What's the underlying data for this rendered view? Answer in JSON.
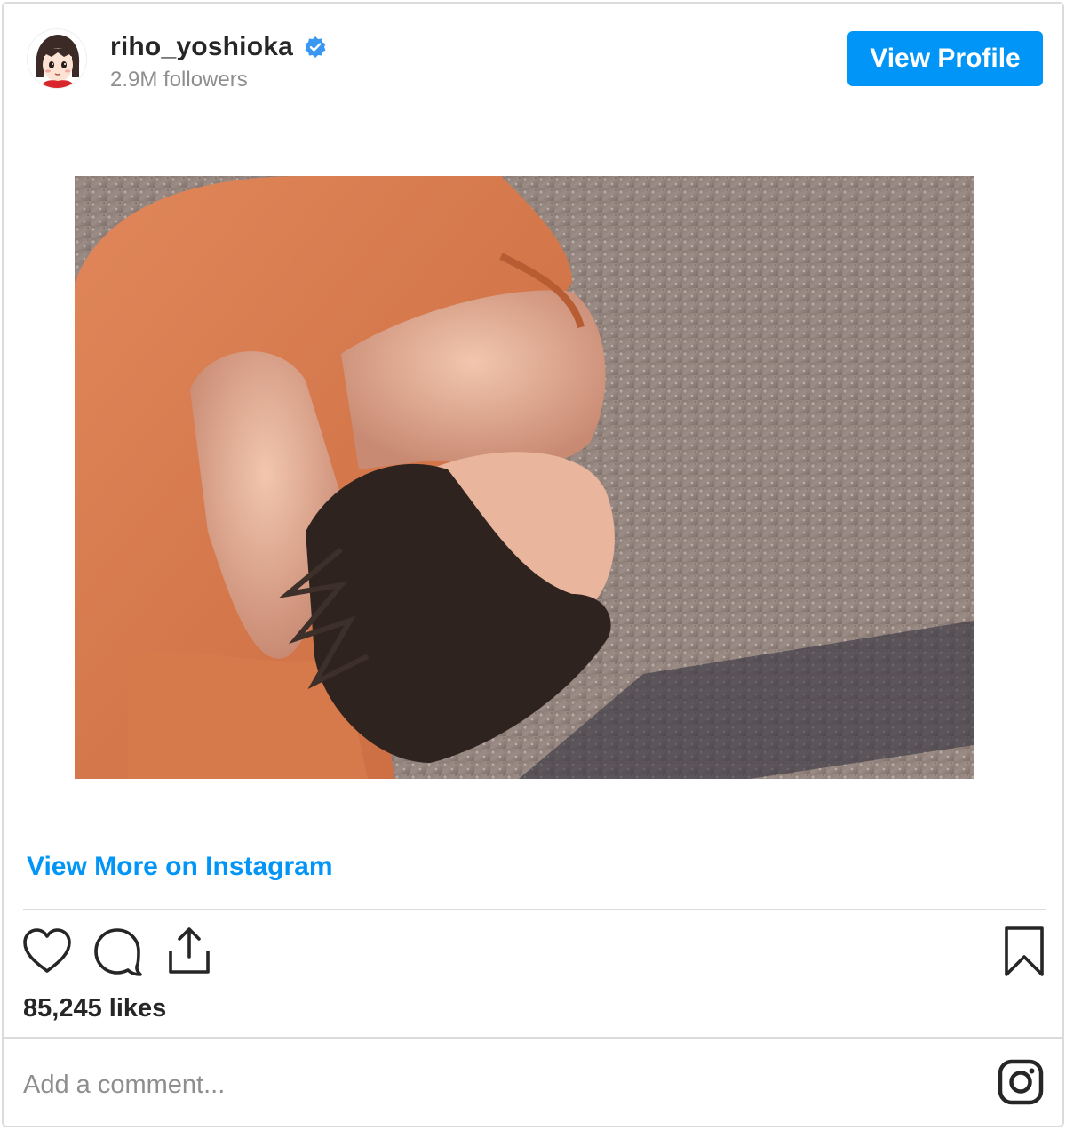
{
  "profile": {
    "username": "riho_yoshioka",
    "verified": true,
    "followers": "2.9M followers"
  },
  "header": {
    "view_profile_label": "View Profile"
  },
  "post": {
    "view_more_label": "View More on Instagram",
    "likes": "85,245 likes"
  },
  "comment": {
    "placeholder": "Add a comment..."
  },
  "icons": {
    "like": "heart-icon",
    "comment": "comment-icon",
    "share": "share-icon",
    "save": "bookmark-icon",
    "instagram": "instagram-logo-icon",
    "verified": "verified-badge-icon"
  },
  "colors": {
    "accent": "#0095f6",
    "text": "#262626",
    "muted": "#8e8e8e",
    "border": "#dbdbdb"
  }
}
